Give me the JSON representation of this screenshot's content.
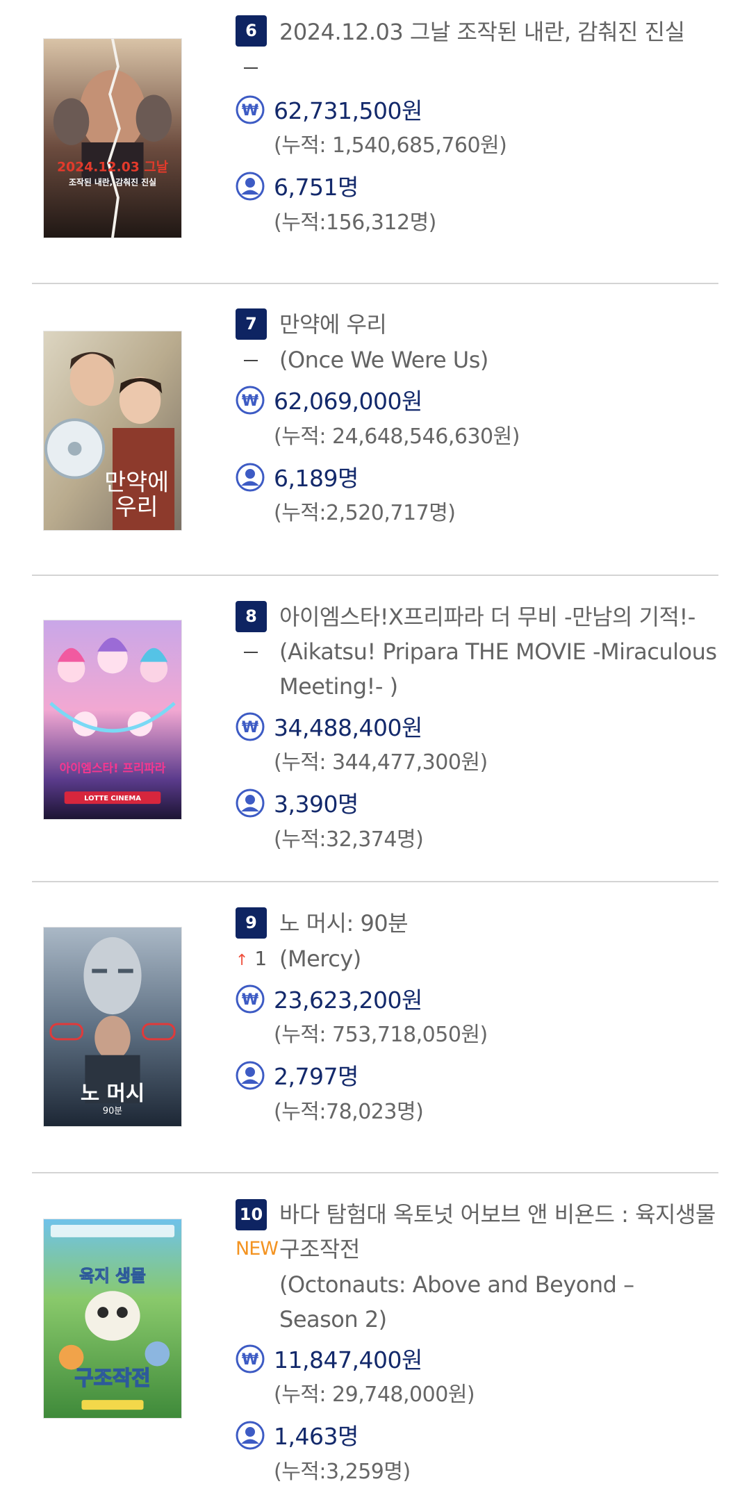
{
  "movies": [
    {
      "rank": "6",
      "title": "2024.12.03 그날 조작된 내란, 감춰진 진실",
      "original_title": "",
      "change": "none",
      "sales": "62,731,500원",
      "sales_total": "(누적: 1,540,685,760원)",
      "audience": "6,751명",
      "audience_total": "(누적:156,312명)",
      "poster_text": "2024.12.03 그날",
      "poster_subtext": "조작된 내란, 감춰진 진실"
    },
    {
      "rank": "7",
      "title": "만약에 우리",
      "original_title": "(Once We Were Us)",
      "change": "none",
      "sales": "62,069,000원",
      "sales_total": "(누적: 24,648,546,630원)",
      "audience": "6,189명",
      "audience_total": "(누적:2,520,717명)",
      "poster_text": "만약에",
      "poster_subtext": "우리"
    },
    {
      "rank": "8",
      "title": "아이엠스타!X프리파라 더 무비 -만남의 기적!-",
      "original_title": "(Aikatsu! Pripara THE MOVIE -Miraculous Meeting!- )",
      "change": "none",
      "sales": "34,488,400원",
      "sales_total": "(누적: 344,477,300원)",
      "audience": "3,390명",
      "audience_total": "(누적:32,374명)",
      "poster_text": "아이엠스타! 프리파라",
      "poster_subtext": "LOTTE CINEMA"
    },
    {
      "rank": "9",
      "title": "노 머시: 90분",
      "original_title": "(Mercy)",
      "change": "up",
      "change_value": "1",
      "sales": "23,623,200원",
      "sales_total": "(누적: 753,718,050원)",
      "audience": "2,797명",
      "audience_total": "(누적:78,023명)",
      "poster_text": "노 머시",
      "poster_subtext": "90분"
    },
    {
      "rank": "10",
      "title": "바다 탐험대 옥토넛 어보브 앤 비욘드 : 육지생물 구조작전",
      "original_title": "(Octonauts: Above and Beyond – Season 2)",
      "change": "new",
      "change_label": "NEW",
      "sales": "11,847,400원",
      "sales_total": "(누적: 29,748,000원)",
      "audience": "1,463명",
      "audience_total": "(누적:3,259명)",
      "poster_text": "육지 생물",
      "poster_subtext": "구조작전"
    }
  ],
  "colors": {
    "badge": "#0e2462",
    "stat_text": "#13296b",
    "icon": "#3d5bc4",
    "up_arrow": "#ef4f3c",
    "new_label": "#f39321",
    "divider": "#d4d4d4"
  },
  "icons": {
    "sales": "won-sign-circle-icon",
    "audience": "person-circle-icon"
  }
}
